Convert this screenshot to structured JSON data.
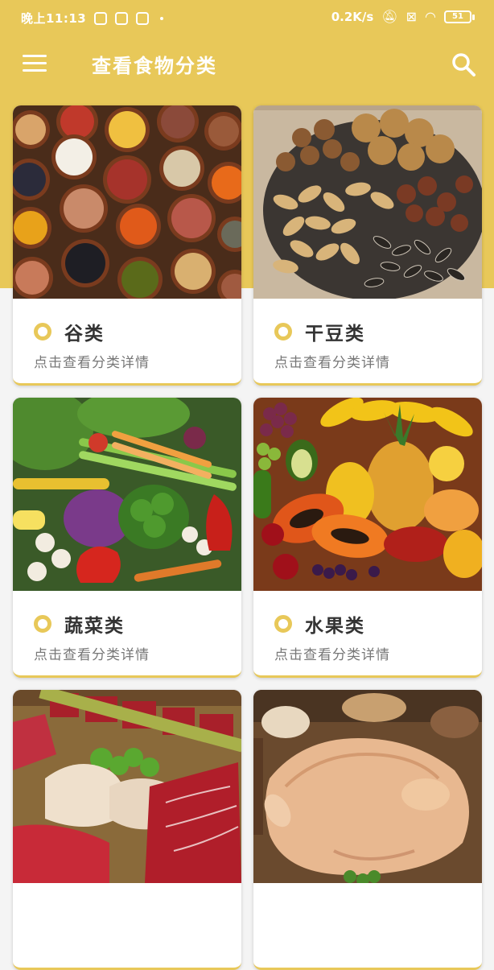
{
  "status_bar": {
    "time": "晚上11:13",
    "network_speed": "0.2K/s",
    "battery": "51"
  },
  "app_bar": {
    "title": "查看食物分类",
    "menu_icon": "menu-icon",
    "search_icon": "search-icon"
  },
  "colors": {
    "accent": "#e8c859",
    "background": "#f4f4f4",
    "card": "#ffffff"
  },
  "categories": [
    {
      "name": "谷类",
      "subtitle": "点击查看分类详情",
      "image": "grains-photo"
    },
    {
      "name": "干豆类",
      "subtitle": "点击查看分类详情",
      "image": "nuts-photo"
    },
    {
      "name": "蔬菜类",
      "subtitle": "点击查看分类详情",
      "image": "vegetables-photo"
    },
    {
      "name": "水果类",
      "subtitle": "点击查看分类详情",
      "image": "fruits-photo"
    },
    {
      "name": "",
      "subtitle": "",
      "image": "meat-photo"
    },
    {
      "name": "",
      "subtitle": "",
      "image": "poultry-photo"
    }
  ]
}
